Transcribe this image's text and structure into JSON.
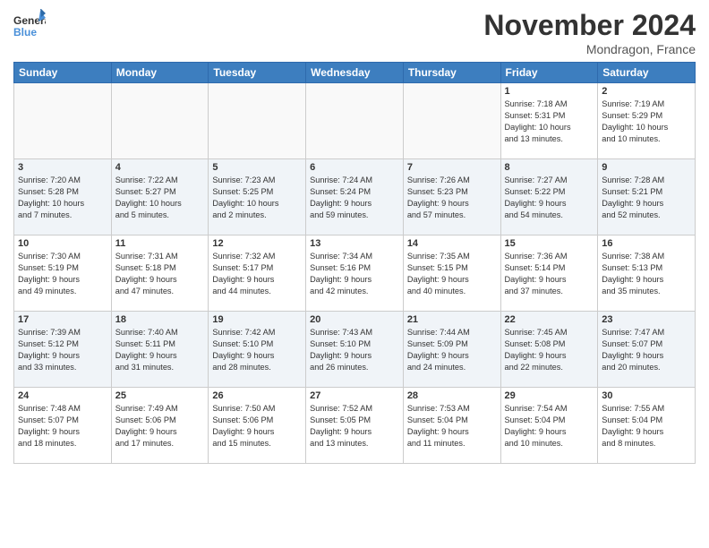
{
  "logo": {
    "line1": "General",
    "line2": "Blue"
  },
  "title": "November 2024",
  "location": "Mondragon, France",
  "weekdays": [
    "Sunday",
    "Monday",
    "Tuesday",
    "Wednesday",
    "Thursday",
    "Friday",
    "Saturday"
  ],
  "weeks": [
    [
      {
        "day": "",
        "info": ""
      },
      {
        "day": "",
        "info": ""
      },
      {
        "day": "",
        "info": ""
      },
      {
        "day": "",
        "info": ""
      },
      {
        "day": "",
        "info": ""
      },
      {
        "day": "1",
        "info": "Sunrise: 7:18 AM\nSunset: 5:31 PM\nDaylight: 10 hours\nand 13 minutes."
      },
      {
        "day": "2",
        "info": "Sunrise: 7:19 AM\nSunset: 5:29 PM\nDaylight: 10 hours\nand 10 minutes."
      }
    ],
    [
      {
        "day": "3",
        "info": "Sunrise: 7:20 AM\nSunset: 5:28 PM\nDaylight: 10 hours\nand 7 minutes."
      },
      {
        "day": "4",
        "info": "Sunrise: 7:22 AM\nSunset: 5:27 PM\nDaylight: 10 hours\nand 5 minutes."
      },
      {
        "day": "5",
        "info": "Sunrise: 7:23 AM\nSunset: 5:25 PM\nDaylight: 10 hours\nand 2 minutes."
      },
      {
        "day": "6",
        "info": "Sunrise: 7:24 AM\nSunset: 5:24 PM\nDaylight: 9 hours\nand 59 minutes."
      },
      {
        "day": "7",
        "info": "Sunrise: 7:26 AM\nSunset: 5:23 PM\nDaylight: 9 hours\nand 57 minutes."
      },
      {
        "day": "8",
        "info": "Sunrise: 7:27 AM\nSunset: 5:22 PM\nDaylight: 9 hours\nand 54 minutes."
      },
      {
        "day": "9",
        "info": "Sunrise: 7:28 AM\nSunset: 5:21 PM\nDaylight: 9 hours\nand 52 minutes."
      }
    ],
    [
      {
        "day": "10",
        "info": "Sunrise: 7:30 AM\nSunset: 5:19 PM\nDaylight: 9 hours\nand 49 minutes."
      },
      {
        "day": "11",
        "info": "Sunrise: 7:31 AM\nSunset: 5:18 PM\nDaylight: 9 hours\nand 47 minutes."
      },
      {
        "day": "12",
        "info": "Sunrise: 7:32 AM\nSunset: 5:17 PM\nDaylight: 9 hours\nand 44 minutes."
      },
      {
        "day": "13",
        "info": "Sunrise: 7:34 AM\nSunset: 5:16 PM\nDaylight: 9 hours\nand 42 minutes."
      },
      {
        "day": "14",
        "info": "Sunrise: 7:35 AM\nSunset: 5:15 PM\nDaylight: 9 hours\nand 40 minutes."
      },
      {
        "day": "15",
        "info": "Sunrise: 7:36 AM\nSunset: 5:14 PM\nDaylight: 9 hours\nand 37 minutes."
      },
      {
        "day": "16",
        "info": "Sunrise: 7:38 AM\nSunset: 5:13 PM\nDaylight: 9 hours\nand 35 minutes."
      }
    ],
    [
      {
        "day": "17",
        "info": "Sunrise: 7:39 AM\nSunset: 5:12 PM\nDaylight: 9 hours\nand 33 minutes."
      },
      {
        "day": "18",
        "info": "Sunrise: 7:40 AM\nSunset: 5:11 PM\nDaylight: 9 hours\nand 31 minutes."
      },
      {
        "day": "19",
        "info": "Sunrise: 7:42 AM\nSunset: 5:10 PM\nDaylight: 9 hours\nand 28 minutes."
      },
      {
        "day": "20",
        "info": "Sunrise: 7:43 AM\nSunset: 5:10 PM\nDaylight: 9 hours\nand 26 minutes."
      },
      {
        "day": "21",
        "info": "Sunrise: 7:44 AM\nSunset: 5:09 PM\nDaylight: 9 hours\nand 24 minutes."
      },
      {
        "day": "22",
        "info": "Sunrise: 7:45 AM\nSunset: 5:08 PM\nDaylight: 9 hours\nand 22 minutes."
      },
      {
        "day": "23",
        "info": "Sunrise: 7:47 AM\nSunset: 5:07 PM\nDaylight: 9 hours\nand 20 minutes."
      }
    ],
    [
      {
        "day": "24",
        "info": "Sunrise: 7:48 AM\nSunset: 5:07 PM\nDaylight: 9 hours\nand 18 minutes."
      },
      {
        "day": "25",
        "info": "Sunrise: 7:49 AM\nSunset: 5:06 PM\nDaylight: 9 hours\nand 17 minutes."
      },
      {
        "day": "26",
        "info": "Sunrise: 7:50 AM\nSunset: 5:06 PM\nDaylight: 9 hours\nand 15 minutes."
      },
      {
        "day": "27",
        "info": "Sunrise: 7:52 AM\nSunset: 5:05 PM\nDaylight: 9 hours\nand 13 minutes."
      },
      {
        "day": "28",
        "info": "Sunrise: 7:53 AM\nSunset: 5:04 PM\nDaylight: 9 hours\nand 11 minutes."
      },
      {
        "day": "29",
        "info": "Sunrise: 7:54 AM\nSunset: 5:04 PM\nDaylight: 9 hours\nand 10 minutes."
      },
      {
        "day": "30",
        "info": "Sunrise: 7:55 AM\nSunset: 5:04 PM\nDaylight: 9 hours\nand 8 minutes."
      }
    ]
  ]
}
